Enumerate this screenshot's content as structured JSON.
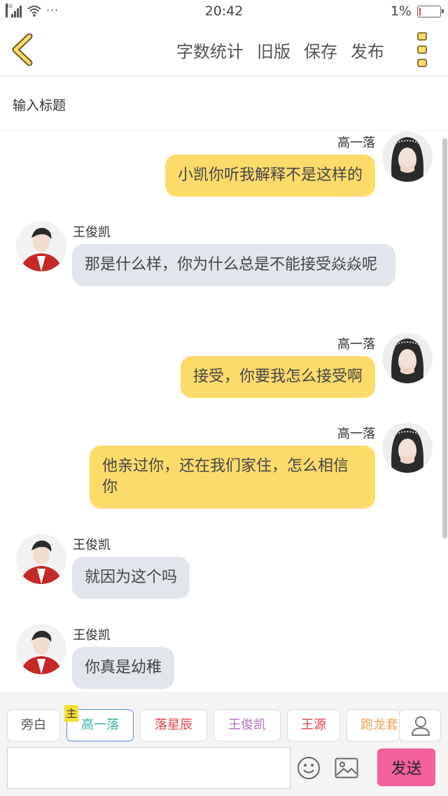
{
  "status_bar": {
    "network": "4G",
    "more_indicator": "···",
    "time": "20:42",
    "battery_percent": "1%",
    "battery_level": 0.01
  },
  "toolbar": {
    "back_icon": "chevron-left-icon",
    "actions": [
      "字数统计",
      "旧版",
      "保存",
      "发布"
    ],
    "more_icon": "more-vertical-icon",
    "accent_color": "#f8dc6e"
  },
  "title_field": {
    "placeholder": "输入标题",
    "value": ""
  },
  "messages": [
    {
      "side": "right",
      "speaker": "高一落",
      "text": "小凯你听我解释不是这样的",
      "avatar": "girl-avatar"
    },
    {
      "side": "left",
      "speaker": "王俊凯",
      "text": "那是什么样，你为什么总是不能接受焱焱呢",
      "avatar": "boy-avatar"
    },
    {
      "side": "right",
      "speaker": "高一落",
      "text": "接受，你要我怎么接受啊",
      "avatar": "girl-avatar"
    },
    {
      "side": "right",
      "speaker": "高一落",
      "text": "他亲过你，还在我们家住，怎么相信你",
      "avatar": "girl-avatar"
    },
    {
      "side": "left",
      "speaker": "王俊凯",
      "text": "就因为这个吗",
      "avatar": "boy-avatar"
    },
    {
      "side": "left",
      "speaker": "王俊凯",
      "text": "你真是幼稚",
      "avatar": "boy-avatar"
    }
  ],
  "bubble_colors": {
    "right": "#fddb6b",
    "left": "#e1e6ec"
  },
  "roles": {
    "main_badge": "主",
    "items": [
      {
        "label": "旁白",
        "color": "#555555"
      },
      {
        "label": "高一落",
        "color": "#35b3a3",
        "active": true
      },
      {
        "label": "落星辰",
        "color": "#e0444a"
      },
      {
        "label": "王俊凯",
        "color": "#b271c8"
      },
      {
        "label": "王源",
        "color": "#e0444a"
      },
      {
        "label": "跑龙套",
        "color": "#f0a35a"
      }
    ],
    "add_icon": "person-icon"
  },
  "composer": {
    "message_value": "",
    "emoji_icon": "emoji-icon",
    "image_icon": "image-icon",
    "send_label": "发送",
    "send_color": "#f4609d"
  }
}
